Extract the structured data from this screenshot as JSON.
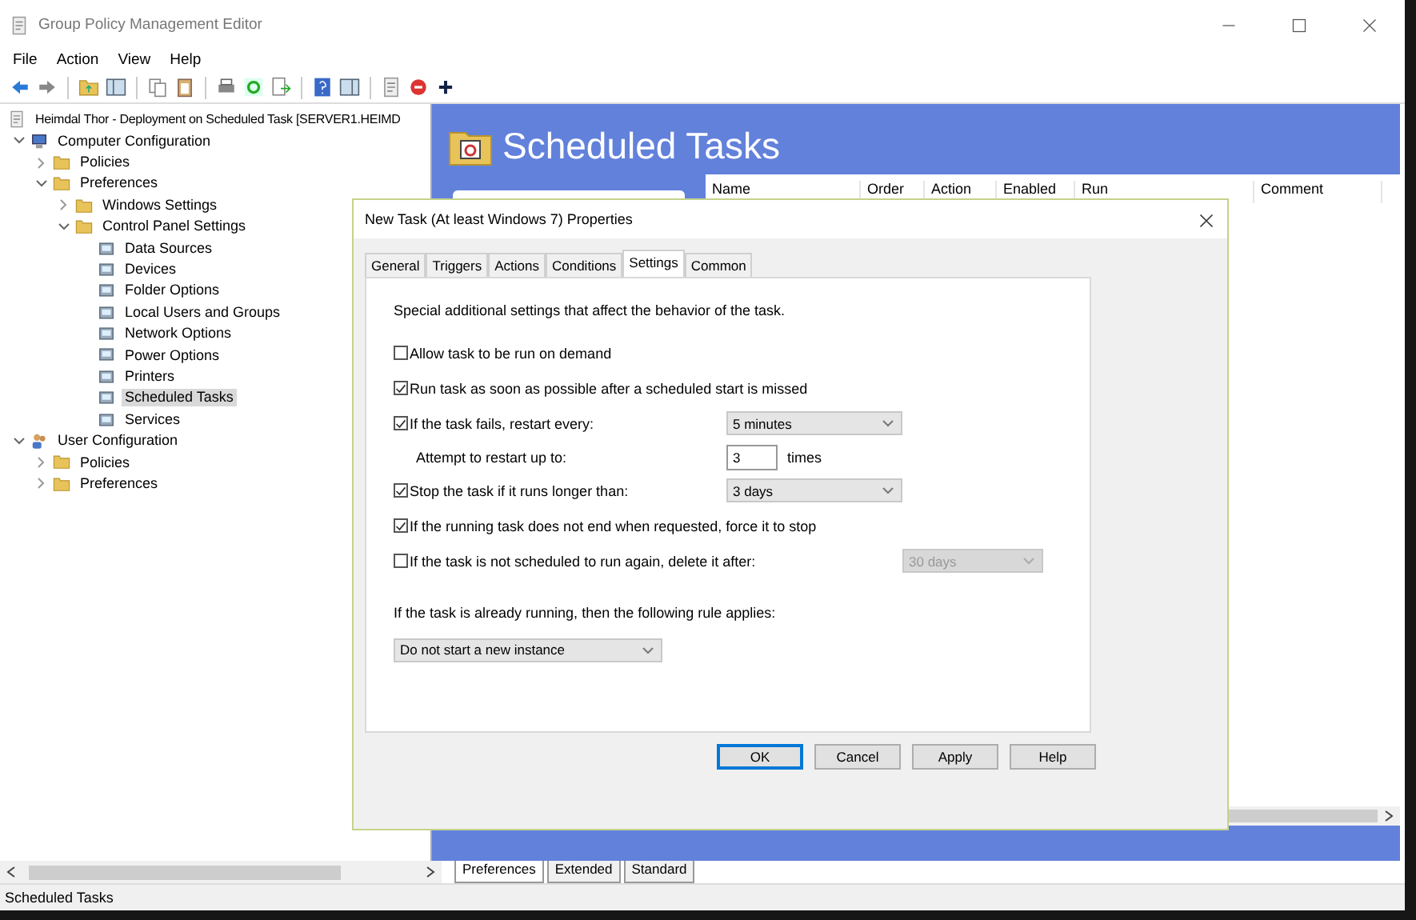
{
  "window": {
    "title": "Group Policy Management Editor"
  },
  "menu": [
    "File",
    "Action",
    "View",
    "Help"
  ],
  "tree": [
    {
      "label": "Heimdal Thor - Deployment on Scheduled Task [SERVER1.HEIMD",
      "selected": false,
      "children": [
        {
          "label": "Computer Configuration",
          "selected": false,
          "expanded": true,
          "children": [
            {
              "label": "Policies",
              "selected": false,
              "expanded": false
            },
            {
              "label": "Preferences",
              "selected": false,
              "expanded": true,
              "children": [
                {
                  "label": "Windows Settings",
                  "selected": false,
                  "expanded": false
                },
                {
                  "label": "Control Panel Settings",
                  "selected": false,
                  "expanded": true,
                  "children": [
                    {
                      "label": "Data Sources",
                      "selected": false
                    },
                    {
                      "label": "Devices",
                      "selected": false
                    },
                    {
                      "label": "Folder Options",
                      "selected": false
                    },
                    {
                      "label": "Local Users and Groups",
                      "selected": false
                    },
                    {
                      "label": "Network Options",
                      "selected": false
                    },
                    {
                      "label": "Power Options",
                      "selected": false
                    },
                    {
                      "label": "Printers",
                      "selected": false
                    },
                    {
                      "label": "Scheduled Tasks",
                      "selected": true
                    },
                    {
                      "label": "Services",
                      "selected": false
                    }
                  ]
                }
              ]
            }
          ]
        },
        {
          "label": "User Configuration",
          "selected": false,
          "expanded": true,
          "children": [
            {
              "label": "Policies",
              "selected": false,
              "expanded": false
            },
            {
              "label": "Preferences",
              "selected": false,
              "expanded": false
            }
          ]
        }
      ]
    }
  ],
  "content": {
    "heading": "Scheduled Tasks",
    "columns": [
      "Name",
      "Order",
      "Action",
      "Enabled",
      "Run",
      "Comment"
    ]
  },
  "dialog": {
    "title": "New Task (At least Windows 7) Properties",
    "tabs": [
      {
        "label": "General",
        "selected": false
      },
      {
        "label": "Triggers",
        "selected": false
      },
      {
        "label": "Actions",
        "selected": false
      },
      {
        "label": "Conditions",
        "selected": false
      },
      {
        "label": "Settings",
        "selected": true
      },
      {
        "label": "Common",
        "selected": false
      }
    ],
    "description": "Special additional settings that affect the behavior of the task.",
    "options": [
      {
        "kind": "checkbox",
        "label": "Allow task to be run on demand",
        "checked": false
      },
      {
        "kind": "checkbox",
        "label": "Run task as soon as possible after a scheduled start is missed",
        "checked": true
      },
      {
        "kind": "checkbox",
        "label": "If the task fails, restart every:",
        "checked": true,
        "select": {
          "value": "5 minutes",
          "disabled": false
        }
      },
      {
        "kind": "number",
        "label": "Attempt to restart up to:",
        "value": "3",
        "unit": "times"
      },
      {
        "kind": "checkbox",
        "label": "Stop the task if it runs longer than:",
        "checked": true,
        "select": {
          "value": "3 days",
          "disabled": false
        }
      },
      {
        "kind": "checkbox",
        "label": "If the running task does not end when requested, force it to stop",
        "checked": true
      },
      {
        "kind": "checkbox",
        "label": "If the task is not scheduled to run again, delete it after:",
        "checked": false,
        "select": {
          "value": "30 days",
          "disabled": true
        }
      }
    ],
    "rule_label": "If the task is already running, then the following rule applies:",
    "rule_value": "Do not start a new instance",
    "buttons": [
      {
        "label": "OK",
        "default": true
      },
      {
        "label": "Cancel",
        "default": false
      },
      {
        "label": "Apply",
        "default": false
      },
      {
        "label": "Help",
        "default": false
      }
    ]
  },
  "bottom_tabs": [
    {
      "label": "Preferences",
      "selected": true
    },
    {
      "label": "Extended",
      "selected": false
    },
    {
      "label": "Standard",
      "selected": false
    }
  ],
  "status_bar": "Scheduled Tasks"
}
